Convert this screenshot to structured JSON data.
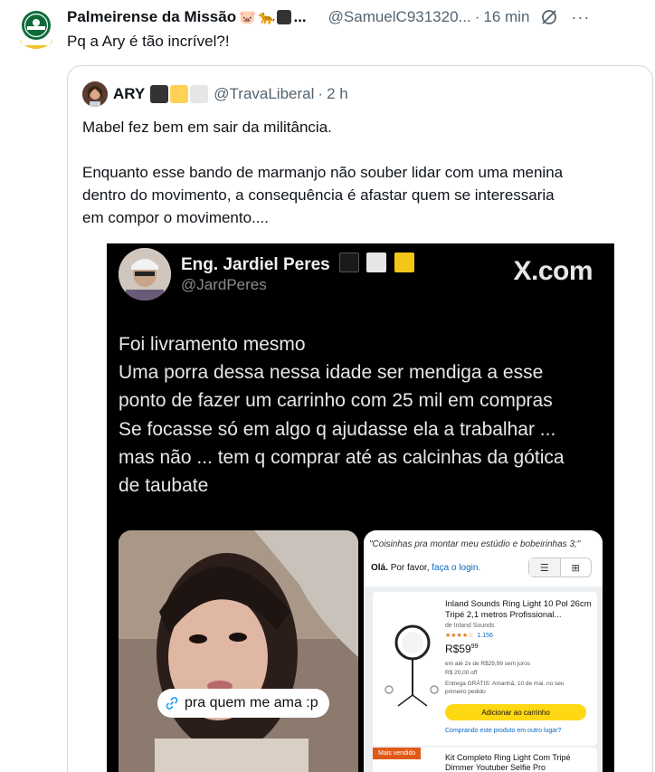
{
  "tweet": {
    "author_name": "Palmeirense da Missão",
    "author_emoji_1": "🐷",
    "author_emoji_2": "🐆",
    "author_name_trunc": "...",
    "handle": "@SamuelC931320...",
    "separator": "·",
    "time": "16 min",
    "text": "Pq a Ary é tão incrível?!",
    "colors": {
      "badge_dark": "#333333"
    }
  },
  "quote": {
    "author_name": "ARY",
    "handle": "@TravaLiberal",
    "separator": "·",
    "time": "2 h",
    "badge_colors": [
      "#333333",
      "#ffd257",
      "#e6e6e6"
    ],
    "paragraph_1": "Mabel fez bem em sair da militância.",
    "paragraph_2_lines": [
      "Enquanto esse bando de marmanjo não souber lidar com uma menina",
      "dentro do movimento, a consequência é afastar quem se interessaria",
      "em compor o movimento...."
    ]
  },
  "media": {
    "author_name": "Eng. Jardiel Peres",
    "handle": "@JardPeres",
    "badge_colors": [
      "#1a1a1a",
      "#e6e6e6",
      "#f5c518"
    ],
    "site_label": "X.com",
    "text_lines": [
      "Foi livramento mesmo",
      "Uma porra dessa nessa idade ser mendiga a esse",
      "ponto de fazer um carrinho com 25 mil em compras",
      "Se focasse só em algo q ajudasse ela a trabalhar ...",
      "mas não ... tem q comprar até as calcinhas da gótica",
      "de taubate"
    ],
    "photo_caption": "pra quem me ama :p",
    "shop": {
      "subtitle": "\"Coisinhas pra montar meu estúdio e bobeirinhas 3;\"",
      "hello_bold": "Olá.",
      "hello_text": "Por favor,",
      "login_link": "faça o login.",
      "product_1": {
        "title": "Inland Sounds Ring Light 10 Pol 26cm Tripé 2,1 metros Profissional...",
        "brand": "de Inland Sounds",
        "stars": "★★★★☆",
        "review_count": "1.156",
        "price_main": "R$59",
        "price_cents": "99",
        "installments": "em até 2x de R$29,99 sem juros",
        "discount": "R$ 20,00 off",
        "delivery": "Entrega GRÁTIS: Amanhã, 10 de mai. no seu",
        "delivery_2": "primeiro pedido",
        "cta": "Adicionar ao carrinho",
        "buy_other": "Comprando este produto em outro lugar?"
      },
      "product_2": {
        "badge": "Mais vendido",
        "title": "Kit Completo Ring Light Com Tripé Dimmer Youtuber Selfie Pro"
      }
    }
  }
}
